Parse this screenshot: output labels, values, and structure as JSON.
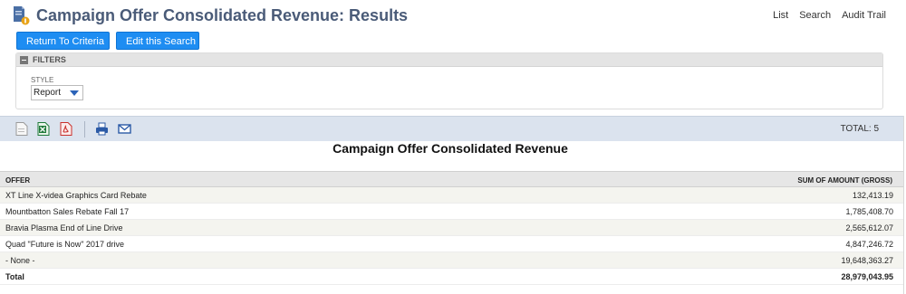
{
  "header": {
    "title": "Campaign Offer Consolidated Revenue: Results",
    "links": [
      "List",
      "Search",
      "Audit Trail"
    ]
  },
  "buttons": {
    "return_label": "Return To Criteria",
    "edit_label": "Edit this Search"
  },
  "filters": {
    "heading": "FILTERS",
    "style_label": "STYLE",
    "style_value": "Report"
  },
  "toolbar": {
    "icons": [
      "export-csv-icon",
      "export-excel-icon",
      "export-pdf-icon",
      "print-icon",
      "email-icon"
    ],
    "total_text": "TOTAL: 5"
  },
  "report": {
    "title": "Campaign Offer Consolidated Revenue",
    "columns": [
      "OFFER",
      "SUM OF AMOUNT (GROSS)"
    ],
    "rows": [
      {
        "offer": "XT Line X-videa Graphics Card Rebate",
        "amount": "132,413.19"
      },
      {
        "offer": "Mountbatton Sales Rebate Fall 17",
        "amount": "1,785,408.70"
      },
      {
        "offer": "Bravia Plasma End of Line Drive",
        "amount": "2,565,612.07"
      },
      {
        "offer": "Quad \"Future is Now\" 2017 drive",
        "amount": "4,847,246.72"
      },
      {
        "offer": "- None -",
        "amount": "19,648,363.27"
      }
    ],
    "total": {
      "label": "Total",
      "amount": "28,979,043.95"
    }
  },
  "colors": {
    "title": "#4a5b78",
    "button": "#1e8df2",
    "toolbar_bg": "#dbe3ee"
  }
}
